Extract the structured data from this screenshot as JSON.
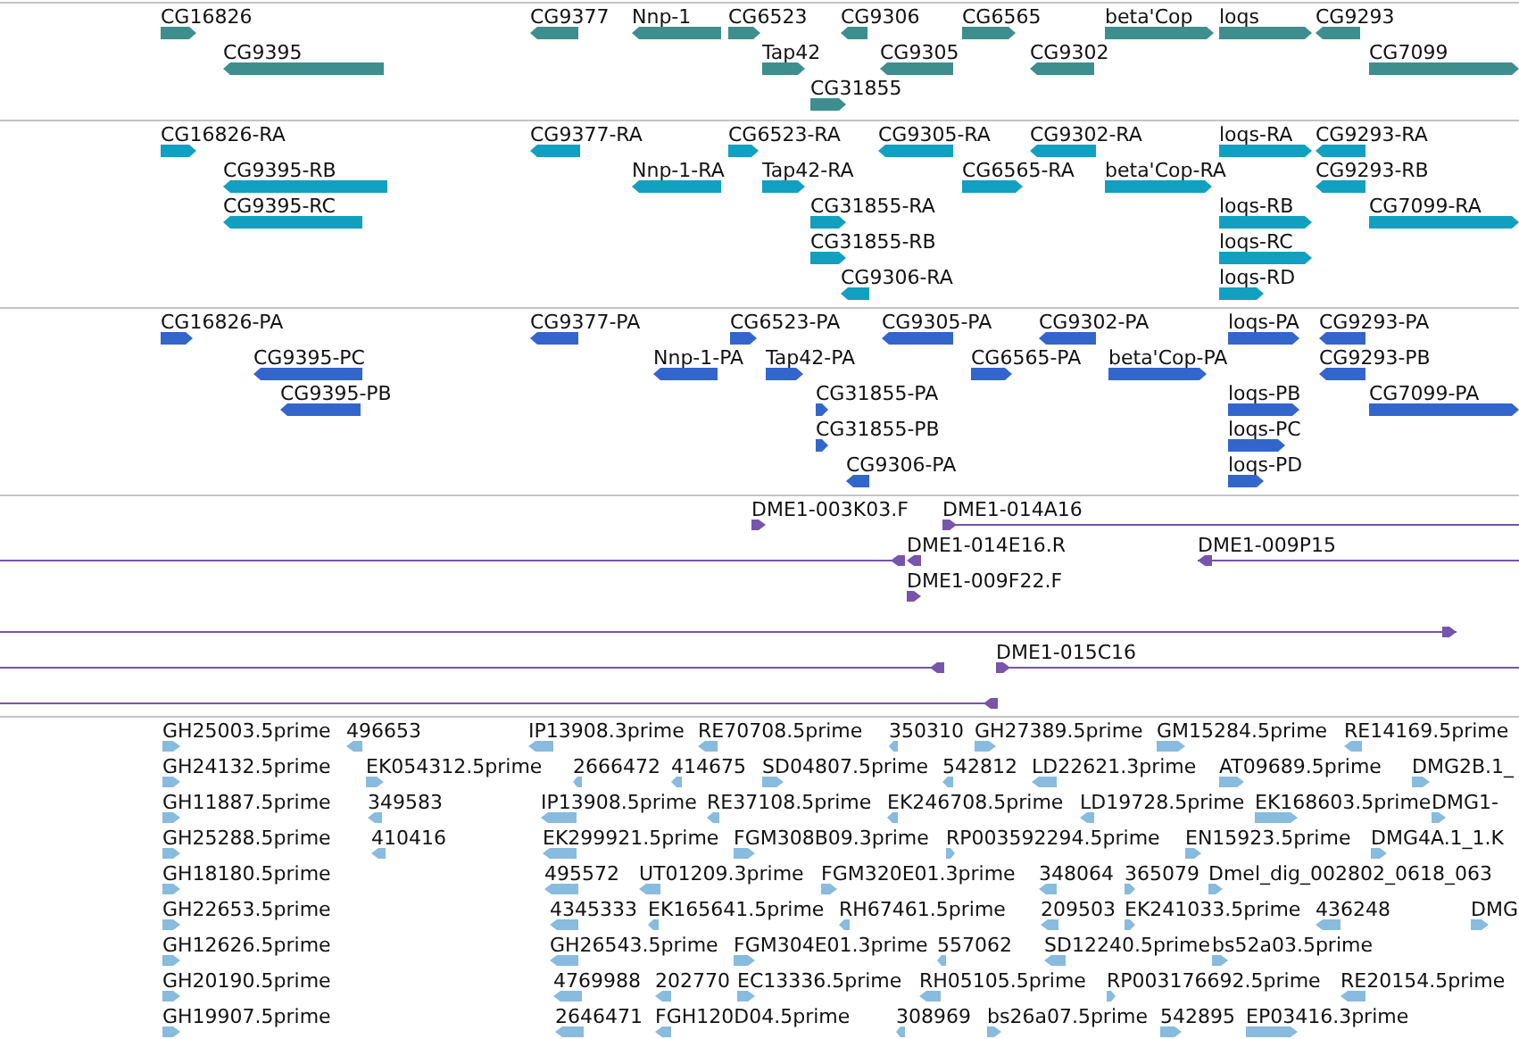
{
  "tracks": [
    {
      "kind": "gene",
      "features": [
        {
          "label": "CG16826",
          "reverse": false
        },
        {
          "label": "CG9377",
          "reverse": true
        },
        {
          "label": "Nnp-1",
          "reverse": true
        },
        {
          "label": "CG6523",
          "reverse": false
        },
        {
          "label": "CG9306",
          "reverse": true
        },
        {
          "label": "CG6565",
          "reverse": false
        },
        {
          "label": "beta'Cop",
          "reverse": false
        },
        {
          "label": "loqs",
          "reverse": false
        },
        {
          "label": "CG9293",
          "reverse": true
        },
        {
          "label": "CG9395",
          "reverse": true
        },
        {
          "label": "Tap42",
          "reverse": false
        },
        {
          "label": "CG9305",
          "reverse": true
        },
        {
          "label": "CG9302",
          "reverse": true
        },
        {
          "label": "CG7099",
          "reverse": false
        },
        {
          "label": "CG31855",
          "reverse": false
        }
      ]
    },
    {
      "kind": "transcript",
      "features": [
        {
          "label": "CG16826-RA",
          "reverse": false
        },
        {
          "label": "CG9377-RA",
          "reverse": true
        },
        {
          "label": "CG6523-RA",
          "reverse": false
        },
        {
          "label": "CG9305-RA",
          "reverse": true
        },
        {
          "label": "CG9302-RA",
          "reverse": true
        },
        {
          "label": "loqs-RA",
          "reverse": false
        },
        {
          "label": "CG9293-RA",
          "reverse": true
        },
        {
          "label": "CG9395-RB",
          "reverse": true
        },
        {
          "label": "Nnp-1-RA",
          "reverse": true
        },
        {
          "label": "Tap42-RA",
          "reverse": false
        },
        {
          "label": "CG6565-RA",
          "reverse": false
        },
        {
          "label": "beta'Cop-RA",
          "reverse": false
        },
        {
          "label": "CG9293-RB",
          "reverse": true
        },
        {
          "label": "CG9395-RC",
          "reverse": true
        },
        {
          "label": "CG31855-RA",
          "reverse": false
        },
        {
          "label": "loqs-RB",
          "reverse": false
        },
        {
          "label": "CG7099-RA",
          "reverse": false
        },
        {
          "label": "CG31855-RB",
          "reverse": false
        },
        {
          "label": "loqs-RC",
          "reverse": false
        },
        {
          "label": "CG9306-RA",
          "reverse": true
        },
        {
          "label": "loqs-RD",
          "reverse": false
        }
      ]
    },
    {
      "kind": "protein",
      "features": [
        {
          "label": "CG16826-PA",
          "reverse": false
        },
        {
          "label": "CG9377-PA",
          "reverse": true
        },
        {
          "label": "CG6523-PA",
          "reverse": false
        },
        {
          "label": "CG9305-PA",
          "reverse": true
        },
        {
          "label": "CG9302-PA",
          "reverse": true
        },
        {
          "label": "loqs-PA",
          "reverse": false
        },
        {
          "label": "CG9293-PA",
          "reverse": true
        },
        {
          "label": "CG9395-PC",
          "reverse": true
        },
        {
          "label": "Nnp-1-PA",
          "reverse": true
        },
        {
          "label": "Tap42-PA",
          "reverse": false
        },
        {
          "label": "CG6565-PA",
          "reverse": false
        },
        {
          "label": "beta'Cop-PA",
          "reverse": false
        },
        {
          "label": "CG9293-PB",
          "reverse": true
        },
        {
          "label": "CG9395-PB",
          "reverse": true
        },
        {
          "label": "CG31855-PA",
          "reverse": false
        },
        {
          "label": "loqs-PB",
          "reverse": false
        },
        {
          "label": "CG7099-PA",
          "reverse": false
        },
        {
          "label": "CG31855-PB",
          "reverse": false
        },
        {
          "label": "loqs-PC",
          "reverse": false
        },
        {
          "label": "CG9306-PA",
          "reverse": true
        },
        {
          "label": "loqs-PD",
          "reverse": false
        }
      ]
    },
    {
      "kind": "bac",
      "features": [
        {
          "label": "DME1-003K03.F",
          "reverse": false
        },
        {
          "label": "DME1-014A16",
          "reverse": false
        },
        {
          "reverse": true
        },
        {
          "label": "DME1-014E16.R",
          "reverse": true
        },
        {
          "label": "DME1-009P15",
          "reverse": true
        },
        {
          "label": "DME1-009F22.F",
          "reverse": false
        },
        {
          "reverse": false
        },
        {
          "reverse": true
        },
        {
          "label": "DME1-015C16",
          "reverse": false
        },
        {
          "reverse": true
        }
      ]
    },
    {
      "kind": "est",
      "features": [
        {
          "label": "GH25003.5prime",
          "reverse": false
        },
        {
          "label": "496653",
          "reverse": true
        },
        {
          "label": "IP13908.3prime",
          "reverse": true
        },
        {
          "label": "RE70708.5prime",
          "reverse": true
        },
        {
          "label": "350310",
          "reverse": true
        },
        {
          "label": "GH27389.5prime",
          "reverse": false
        },
        {
          "label": "GM15284.5prime",
          "reverse": false
        },
        {
          "label": "RE14169.5prime",
          "reverse": true
        },
        {
          "label": "GH24132.5prime",
          "reverse": false
        },
        {
          "label": "EK054312.5prime",
          "reverse": false
        },
        {
          "label": "2666472",
          "reverse": true
        },
        {
          "label": "414675",
          "reverse": true
        },
        {
          "label": "SD04807.5prime",
          "reverse": false
        },
        {
          "label": "542812",
          "reverse": true
        },
        {
          "label": "LD22621.3prime",
          "reverse": true
        },
        {
          "label": "AT09689.5prime",
          "reverse": false
        },
        {
          "label": "DMG2B.1_",
          "reverse": false
        },
        {
          "label": "GH11887.5prime",
          "reverse": false
        },
        {
          "label": "349583",
          "reverse": true
        },
        {
          "label": "IP13908.5prime",
          "reverse": true
        },
        {
          "label": "RE37108.5prime",
          "reverse": true
        },
        {
          "label": "EK246708.5prime",
          "reverse": true
        },
        {
          "label": "LD19728.5prime",
          "reverse": true
        },
        {
          "label": "EK168603.5prime",
          "reverse": false
        },
        {
          "label": "DMG1-",
          "reverse": false
        },
        {
          "label": "GH25288.5prime",
          "reverse": false
        },
        {
          "label": "410416",
          "reverse": true
        },
        {
          "label": "EK299921.5prime",
          "reverse": true
        },
        {
          "label": "FGM308B09.3prime",
          "reverse": false
        },
        {
          "label": "RP003592294.5prime",
          "reverse": false
        },
        {
          "label": "EN15923.5prime",
          "reverse": false
        },
        {
          "label": "DMG4A.1_1.K",
          "reverse": false
        },
        {
          "label": "GH18180.5prime",
          "reverse": false
        },
        {
          "label": "495572",
          "reverse": true
        },
        {
          "label": "UT01209.3prime",
          "reverse": true
        },
        {
          "label": "FGM320E01.3prime",
          "reverse": false
        },
        {
          "label": "348064",
          "reverse": true
        },
        {
          "label": "365079",
          "reverse": false
        },
        {
          "label": "Dmel_dig_002802_0618_063",
          "reverse": false
        },
        {
          "label": "GH22653.5prime",
          "reverse": false
        },
        {
          "label": "4345333",
          "reverse": true
        },
        {
          "label": "EK165641.5prime",
          "reverse": true
        },
        {
          "label": "RH67461.5prime",
          "reverse": true
        },
        {
          "label": "209503",
          "reverse": true
        },
        {
          "label": "EK241033.5prime",
          "reverse": false
        },
        {
          "label": "436248",
          "reverse": true
        },
        {
          "label": "DMG",
          "reverse": false
        },
        {
          "label": "GH12626.5prime",
          "reverse": false
        },
        {
          "label": "GH26543.5prime",
          "reverse": true
        },
        {
          "label": "FGM304E01.3prime",
          "reverse": false
        },
        {
          "label": "557062",
          "reverse": true
        },
        {
          "label": "SD12240.5prime",
          "reverse": true
        },
        {
          "label": "bs52a03.5prime",
          "reverse": false
        },
        {
          "label": "GH20190.5prime",
          "reverse": false
        },
        {
          "label": "4769988",
          "reverse": true
        },
        {
          "label": "202770",
          "reverse": true
        },
        {
          "label": "EC13336.5prime",
          "reverse": false
        },
        {
          "label": "RH05105.5prime",
          "reverse": true
        },
        {
          "label": "RP003176692.5prime",
          "reverse": false
        },
        {
          "label": "RE20154.5prime",
          "reverse": true
        },
        {
          "label": "GH19907.5prime",
          "reverse": false
        },
        {
          "label": "2646471",
          "reverse": true
        },
        {
          "label": "FGH120D04.5prime",
          "reverse": true
        },
        {
          "label": "308969",
          "reverse": true
        },
        {
          "label": "bs26a07.5prime",
          "reverse": false
        },
        {
          "label": "542895",
          "reverse": false
        },
        {
          "label": "EP03416.3prime",
          "reverse": false
        }
      ]
    }
  ]
}
